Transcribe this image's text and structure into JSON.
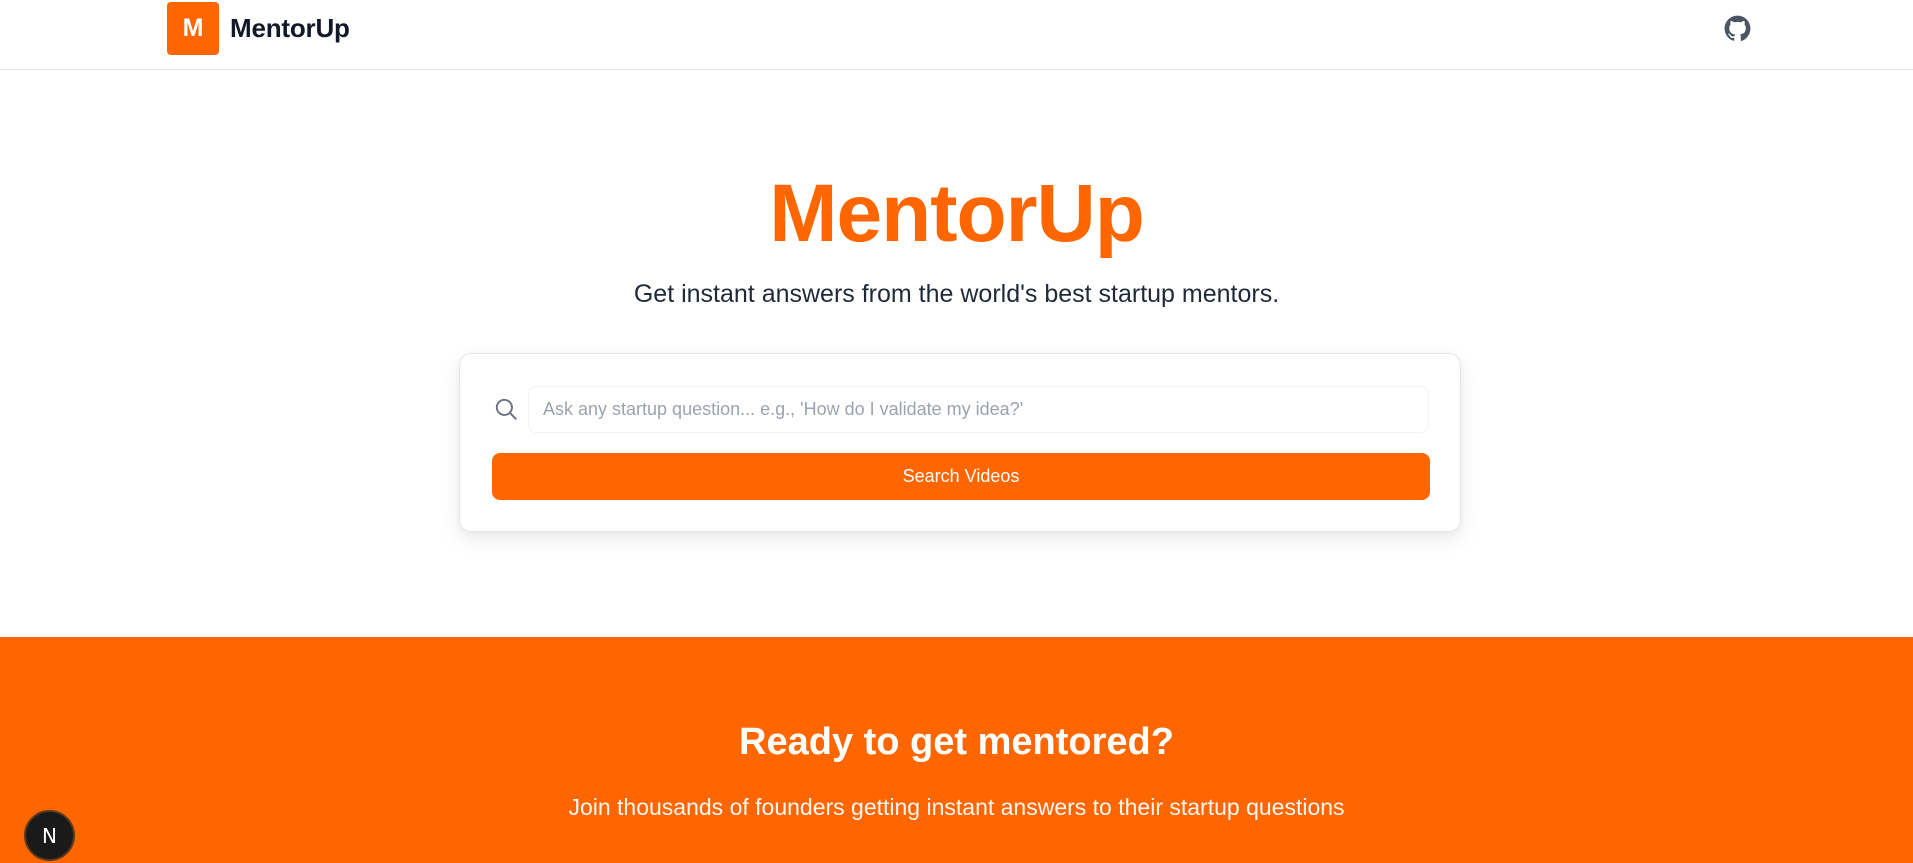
{
  "header": {
    "logo_letter": "M",
    "brand_name": "MentorUp",
    "github_icon": "github-icon"
  },
  "hero": {
    "title": "MentorUp",
    "subtitle": "Get instant answers from the world's best startup mentors."
  },
  "search": {
    "icon": "search-icon",
    "placeholder": "Ask any startup question... e.g., 'How do I validate my idea?'",
    "value": "",
    "button_label": "Search Videos"
  },
  "cta": {
    "title": "Ready to get mentored?",
    "subtitle": "Join thousands of founders getting instant answers to their startup questions"
  },
  "dev_badge": {
    "label": "N"
  },
  "colors": {
    "accent": "#ff6600",
    "text_dark": "#111827",
    "placeholder": "#9ca3af"
  }
}
